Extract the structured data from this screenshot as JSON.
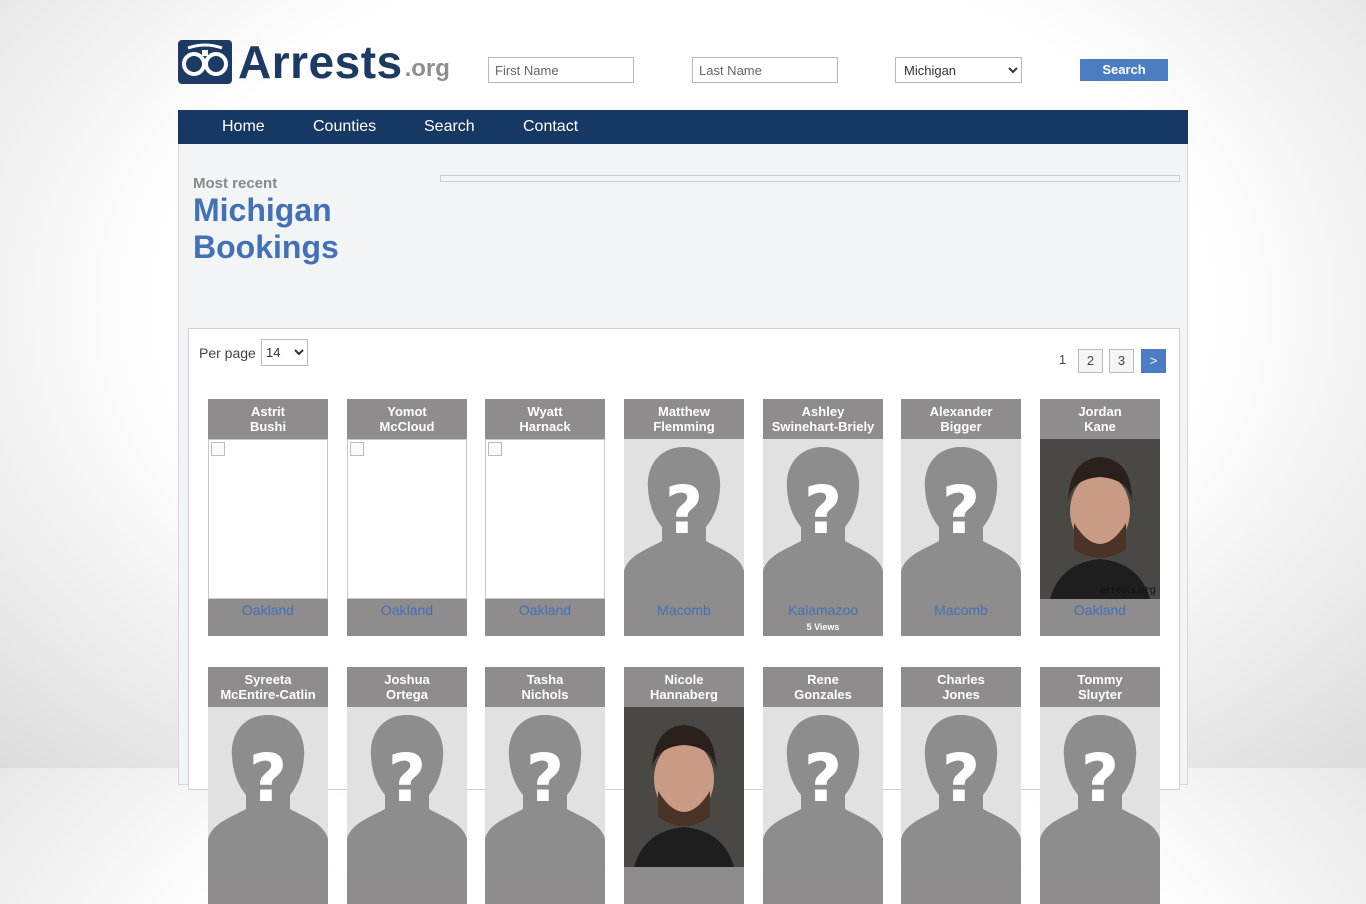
{
  "logo": {
    "word": "Arrests",
    "suffix": ".org"
  },
  "search": {
    "first_placeholder": "First Name",
    "last_placeholder": "Last Name",
    "state_selected": "Michigan",
    "button_label": "Search"
  },
  "nav": {
    "items": [
      "Home",
      "Counties",
      "Search",
      "Contact"
    ]
  },
  "heading": {
    "eyebrow": "Most recent",
    "title_line1": "Michigan",
    "title_line2": "Bookings"
  },
  "listing": {
    "per_page_label": "Per page",
    "per_page_value": "14",
    "pagination": {
      "current": "1",
      "pages": [
        "2",
        "3"
      ],
      "next": ">"
    }
  },
  "cards": [
    {
      "first": "Astrit",
      "last": "Bushi",
      "county": "Oakland",
      "photo": "broken-image-icon",
      "views": ""
    },
    {
      "first": "Yomot",
      "last": "McCloud",
      "county": "Oakland",
      "photo": "broken-image-icon",
      "views": ""
    },
    {
      "first": "Wyatt",
      "last": "Harnack",
      "county": "Oakland",
      "photo": "broken-image-icon",
      "views": ""
    },
    {
      "first": "Matthew",
      "last": "Flemming",
      "county": "Macomb",
      "photo": "unknown-person-icon",
      "views": ""
    },
    {
      "first": "Ashley",
      "last": "Swinehart-Briely",
      "county": "Kalamazoo",
      "photo": "unknown-person-icon",
      "views": "5 Views"
    },
    {
      "first": "Alexander",
      "last": "Bigger",
      "county": "Macomb",
      "photo": "unknown-person-icon",
      "views": ""
    },
    {
      "first": "Jordan",
      "last": "Kane",
      "county": "Oakland",
      "photo": "mugshot",
      "watermark": "arrests.org",
      "views": ""
    },
    {
      "first": "Syreeta",
      "last": "McEntire-Catlin",
      "county": "",
      "photo": "unknown-person-icon",
      "views": ""
    },
    {
      "first": "Joshua",
      "last": "Ortega",
      "county": "",
      "photo": "unknown-person-icon",
      "views": ""
    },
    {
      "first": "Tasha",
      "last": "Nichols",
      "county": "",
      "photo": "unknown-person-icon",
      "views": ""
    },
    {
      "first": "Nicole",
      "last": "Hannaberg",
      "county": "",
      "photo": "mugshot",
      "views": ""
    },
    {
      "first": "Rene",
      "last": "Gonzales",
      "county": "",
      "photo": "unknown-person-icon",
      "views": ""
    },
    {
      "first": "Charles",
      "last": "Jones",
      "county": "",
      "photo": "unknown-person-icon",
      "views": ""
    },
    {
      "first": "Tommy",
      "last": "Sluyter",
      "county": "",
      "photo": "unknown-person-icon",
      "views": ""
    }
  ],
  "colors": {
    "nav_bg": "#163862",
    "accent": "#4271b7",
    "card_bg": "#8e8c8c",
    "button": "#4c7cc1"
  }
}
